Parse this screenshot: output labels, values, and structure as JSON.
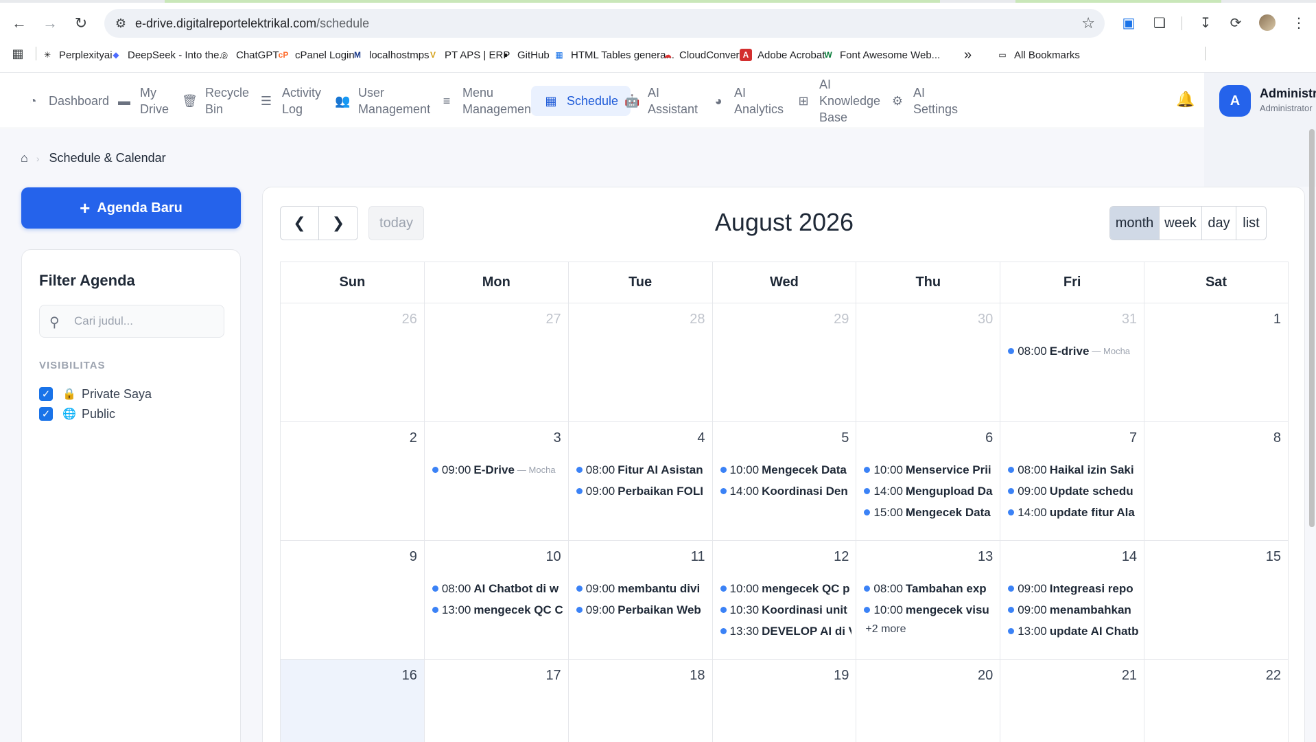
{
  "browser": {
    "url_domain": "e-drive.digitalreportelektrikal.com",
    "url_path": "/schedule",
    "bookmarks": [
      {
        "label": "Perplexityai",
        "icon": "perplexity-icon"
      },
      {
        "label": "DeepSeek - Into the...",
        "icon": "deepseek-icon"
      },
      {
        "label": "ChatGPT",
        "icon": "chatgpt-icon"
      },
      {
        "label": "cPanel Login",
        "icon": "cpanel-icon"
      },
      {
        "label": "localhostmps",
        "icon": "localhost-icon"
      },
      {
        "label": "PT APS | ERP",
        "icon": "aps-icon"
      },
      {
        "label": "GitHub",
        "icon": "github-icon"
      },
      {
        "label": "HTML Tables genera...",
        "icon": "tables-icon"
      },
      {
        "label": "CloudConvert",
        "icon": "cloudconvert-icon"
      },
      {
        "label": "Adobe Acrobat",
        "icon": "acrobat-icon"
      },
      {
        "label": "Font Awesome Web...",
        "icon": "fontawesome-icon"
      }
    ],
    "more_bookmarks": "»",
    "all_bookmarks": "All Bookmarks"
  },
  "nav": {
    "items": [
      {
        "label": "Dashboard",
        "icon": "gauge-icon"
      },
      {
        "label": "My\nDrive",
        "icon": "drive-icon"
      },
      {
        "label": "Recycle\nBin",
        "icon": "trash-icon"
      },
      {
        "label": "Activity\nLog",
        "icon": "list-check-icon"
      },
      {
        "label": "User\nManagement",
        "icon": "users-icon"
      },
      {
        "label": "Menu\nManagement",
        "icon": "bars-icon"
      },
      {
        "label": "Schedule",
        "icon": "calendar-icon"
      },
      {
        "label": "AI\nAssistant",
        "icon": "robot-icon"
      },
      {
        "label": "AI\nAnalytics",
        "icon": "chart-pie-icon"
      },
      {
        "label": "AI\nKnowledge\nBase",
        "icon": "sitemap-icon"
      },
      {
        "label": "AI\nSettings",
        "icon": "sliders-icon"
      }
    ],
    "user": {
      "initial": "A",
      "name": "Administrator",
      "role": "Administrator"
    }
  },
  "breadcrumb": {
    "current": "Schedule & Calendar"
  },
  "sidebar": {
    "new_button": "Agenda Baru",
    "filter_title": "Filter Agenda",
    "search_placeholder": "Cari judul...",
    "visibility_label": "VISIBILITAS",
    "visibility": [
      {
        "label": "Private Saya",
        "checked": true,
        "icon": "lock-icon"
      },
      {
        "label": "Public",
        "checked": true,
        "icon": "globe-icon"
      }
    ]
  },
  "calendar": {
    "title": "August 2026",
    "today_label": "today",
    "views": [
      "month",
      "week",
      "day",
      "list"
    ],
    "active_view": "month",
    "weekdays": [
      "Sun",
      "Mon",
      "Tue",
      "Wed",
      "Thu",
      "Fri",
      "Sat"
    ],
    "event_color": "#3b82f6",
    "weeks": [
      [
        {
          "day": "26",
          "other": true,
          "events": []
        },
        {
          "day": "27",
          "other": true,
          "events": []
        },
        {
          "day": "28",
          "other": true,
          "events": []
        },
        {
          "day": "29",
          "other": true,
          "events": []
        },
        {
          "day": "30",
          "other": true,
          "events": []
        },
        {
          "day": "31",
          "other": true,
          "events": [
            {
              "time": "08:00",
              "title": "E-drive",
              "author": "— Mocha"
            }
          ]
        },
        {
          "day": "1",
          "events": []
        }
      ],
      [
        {
          "day": "2",
          "events": []
        },
        {
          "day": "3",
          "events": [
            {
              "time": "09:00",
              "title": "E-Drive",
              "author": "— Mocha"
            }
          ]
        },
        {
          "day": "4",
          "events": [
            {
              "time": "08:00",
              "title": "Fitur AI Asistan"
            },
            {
              "time": "09:00",
              "title": "Perbaikan FOLI"
            }
          ]
        },
        {
          "day": "5",
          "events": [
            {
              "time": "10:00",
              "title": "Mengecek Data"
            },
            {
              "time": "14:00",
              "title": "Koordinasi Den"
            }
          ]
        },
        {
          "day": "6",
          "events": [
            {
              "time": "10:00",
              "title": "Menservice Prii"
            },
            {
              "time": "14:00",
              "title": "Mengupload Da"
            },
            {
              "time": "15:00",
              "title": "Mengecek Data"
            }
          ]
        },
        {
          "day": "7",
          "events": [
            {
              "time": "08:00",
              "title": "Haikal izin Saki"
            },
            {
              "time": "09:00",
              "title": "Update schedu"
            },
            {
              "time": "14:00",
              "title": "update fitur Ala"
            }
          ]
        },
        {
          "day": "8",
          "events": []
        }
      ],
      [
        {
          "day": "9",
          "events": []
        },
        {
          "day": "10",
          "events": [
            {
              "time": "08:00",
              "title": "AI Chatbot di w"
            },
            {
              "time": "13:00",
              "title": "mengecek QC C"
            }
          ]
        },
        {
          "day": "11",
          "events": [
            {
              "time": "09:00",
              "title": "membantu divi"
            },
            {
              "time": "09:00",
              "title": "Perbaikan Web"
            }
          ]
        },
        {
          "day": "12",
          "events": [
            {
              "time": "10:00",
              "title": "mengecek QC p"
            },
            {
              "time": "10:30",
              "title": "Koordinasi unit"
            },
            {
              "time": "13:30",
              "title": "DEVELOP AI di V"
            }
          ]
        },
        {
          "day": "13",
          "events": [
            {
              "time": "08:00",
              "title": "Tambahan exp"
            },
            {
              "time": "10:00",
              "title": "mengecek visu"
            }
          ],
          "more": "+2 more"
        },
        {
          "day": "14",
          "events": [
            {
              "time": "09:00",
              "title": "Integreasi repo"
            },
            {
              "time": "09:00",
              "title": "menambahkan"
            },
            {
              "time": "13:00",
              "title": "update AI Chatb"
            }
          ]
        },
        {
          "day": "15",
          "events": []
        }
      ],
      [
        {
          "day": "16",
          "today": true,
          "events": []
        },
        {
          "day": "17",
          "events": []
        },
        {
          "day": "18",
          "events": []
        },
        {
          "day": "19",
          "events": []
        },
        {
          "day": "20",
          "events": []
        },
        {
          "day": "21",
          "events": []
        },
        {
          "day": "22",
          "events": []
        }
      ]
    ]
  }
}
